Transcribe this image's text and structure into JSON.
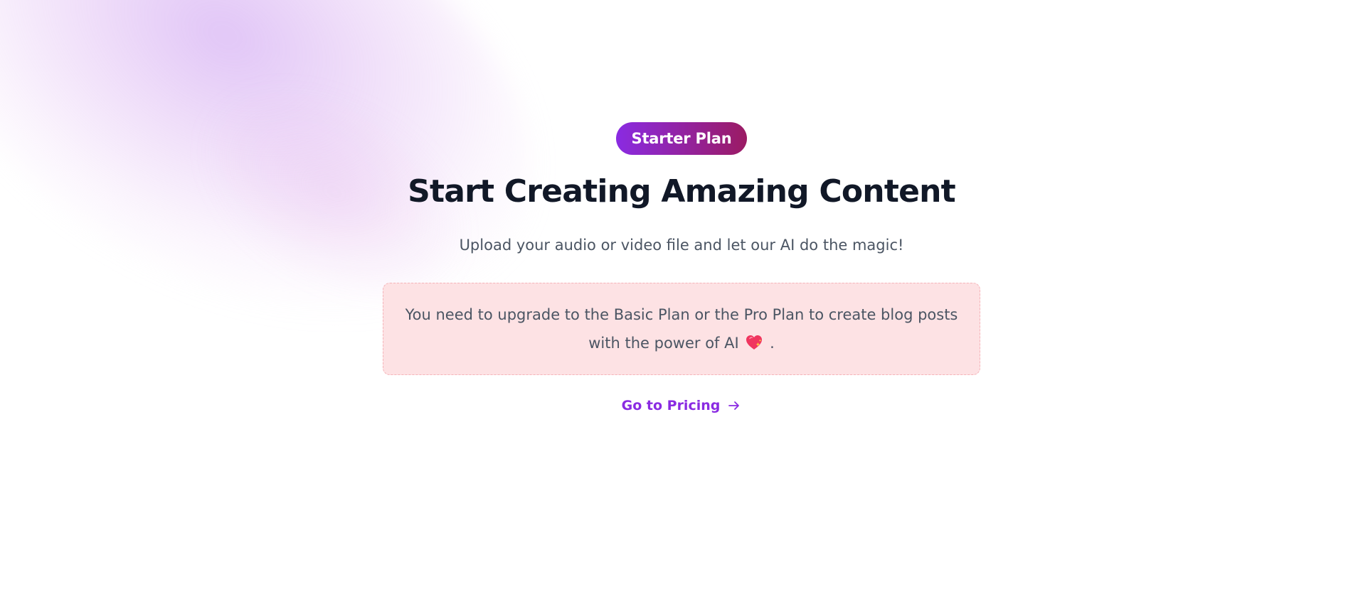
{
  "plan_badge": "Starter Plan",
  "hero": {
    "title": "Start Creating Amazing Content",
    "subtitle": "Upload your audio or video file and let our AI do the magic!"
  },
  "notice": {
    "text_before_icon": "You need to upgrade to the Basic Plan or the Pro Plan to create blog posts with the power of AI",
    "icon": "sparkling-heart-icon",
    "text_after_icon": "."
  },
  "pricing_link": {
    "label": "Go to Pricing",
    "icon": "arrow-right-icon"
  },
  "colors": {
    "accent": "#8a2be2",
    "badge_gradient_end": "#9b1b63",
    "heading": "#111827",
    "body_text": "#4b5563",
    "notice_bg": "#fde2e4",
    "notice_border": "#f5b3b8"
  }
}
